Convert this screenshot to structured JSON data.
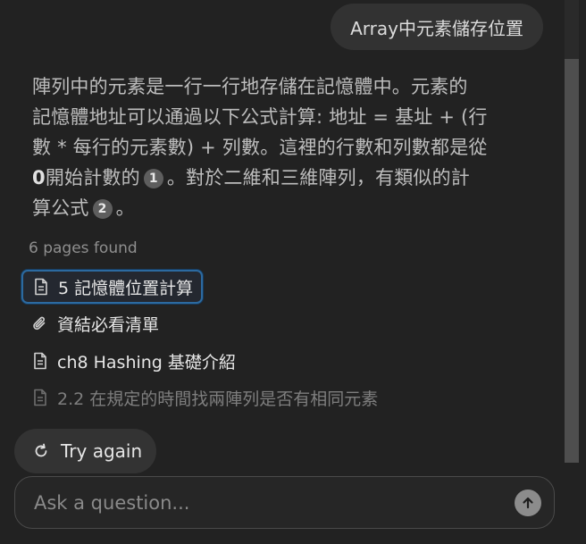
{
  "conversation": {
    "user_question": "Array中元素儲存位置",
    "answer": {
      "line1": "陣列中的元素是一行一行地存儲在記憶體中。元素的",
      "line2": "記憶體地址可以通過以下公式計算: 地址 = 基址 + (行",
      "line3": "數 * 每行的元素數) + 列數。這裡的行數和列數都是從",
      "line4_bold": "0",
      "line4_rest": "開始計數的",
      "citation_1": "1",
      "line4_after": "。對於二維和三維陣列，有類似的計",
      "line5": "算公式",
      "citation_2": "2",
      "line5_after": "。"
    }
  },
  "sources": {
    "count_label": "6 pages found",
    "items": [
      {
        "label": "5 記憶體位置計算",
        "icon": "document-icon",
        "selected": true
      },
      {
        "label": "資結必看清單",
        "icon": "paperclip-icon"
      },
      {
        "label": "ch8 Hashing 基礎介紹",
        "icon": "document-icon"
      },
      {
        "label": "2.2 在規定的時間找兩陣列是否有相同元素",
        "icon": "document-icon",
        "faded": true
      }
    ]
  },
  "actions": {
    "try_again_label": "Try again"
  },
  "composer": {
    "placeholder": "Ask a question...",
    "value": ""
  },
  "colors": {
    "background": "#222222",
    "bubble": "#323232",
    "selected_border": "#2c6aa0"
  }
}
